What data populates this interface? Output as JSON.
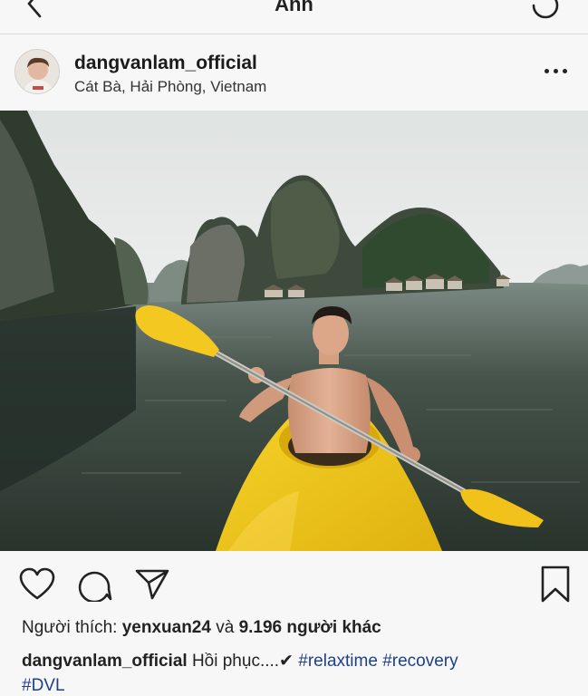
{
  "nav": {
    "title": "Ảnh"
  },
  "post": {
    "username": "dangvanlam_official",
    "location": "Cát Bà, Hải Phòng, Vietnam"
  },
  "engagement": {
    "likes_prefix": "Người thích: ",
    "liker": "yenxuan24",
    "likes_joiner": " và ",
    "others": "9.196 người khác"
  },
  "caption": {
    "username": "dangvanlam_official",
    "text": " Hồi phục....✔ ",
    "tag1": "#relaxtime",
    "tag2": " #recovery",
    "tag3": "#DVL"
  },
  "colors": {
    "hashtag": "#1e3f8a",
    "kayak": "#f2c51c",
    "water": "#3c4a40"
  },
  "icons": [
    "back-icon",
    "refresh-icon",
    "more-icon",
    "heart-icon",
    "comment-icon",
    "share-icon",
    "bookmark-icon"
  ]
}
